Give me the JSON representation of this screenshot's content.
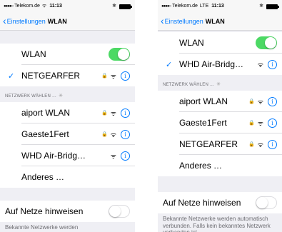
{
  "left": {
    "status": {
      "carrier": "Telekom.de",
      "time": "11:13"
    },
    "nav": {
      "back_label": "Einstellungen",
      "title": "WLAN"
    },
    "wlan_label": "WLAN",
    "connected_network": "NETGEARFER",
    "section_header": "NETZWERK WÄHLEN …",
    "networks": [
      {
        "name": "aiport WLAN"
      },
      {
        "name": "Gaeste1Fert"
      },
      {
        "name": "WHD Air-Bridg…"
      },
      {
        "name": "Anderes …"
      }
    ],
    "ask_label": "Auf Netze hinweisen",
    "footer": "Bekannte Netzwerke werden"
  },
  "right": {
    "status": {
      "carrier": "Telekom.de",
      "network": "LTE",
      "time": "11:13"
    },
    "nav": {
      "back_label": "Einstellungen",
      "title": "WLAN"
    },
    "wlan_label": "WLAN",
    "connected_network": "WHD Air-Bridg…",
    "section_header": "NETZWERK WÄHLEN …",
    "networks": [
      {
        "name": "aiport WLAN"
      },
      {
        "name": "Gaeste1Fert"
      },
      {
        "name": "NETGEARFER"
      },
      {
        "name": "Anderes …"
      }
    ],
    "ask_label": "Auf Netze hinweisen",
    "footer": "Bekannte Netzwerke werden automatisch verbunden. Falls kein bekanntes Netzwerk vorhanden ist"
  },
  "colors": {
    "accent": "#007aff",
    "toggle_on": "#4cd964",
    "background": "#efeff4"
  }
}
